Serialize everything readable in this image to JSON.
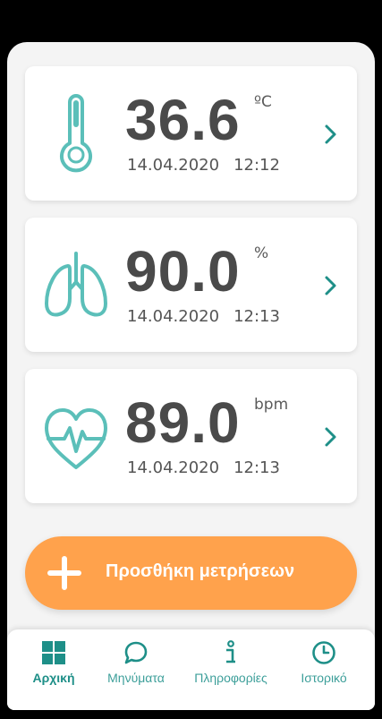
{
  "colors": {
    "accent": "#5bbfb9",
    "tab_accent": "#1e8f88",
    "button": "#ffa24c",
    "value_text": "#4a4a4a"
  },
  "measurements": [
    {
      "icon": "thermometer-icon",
      "value": "36.6",
      "unit": "ºC",
      "date": "14.04.2020",
      "time": "12:12"
    },
    {
      "icon": "lungs-icon",
      "value": "90.0",
      "unit": "%",
      "date": "14.04.2020",
      "time": "12:13"
    },
    {
      "icon": "heart-rate-icon",
      "value": "89.0",
      "unit": "bpm",
      "date": "14.04.2020",
      "time": "12:13"
    }
  ],
  "add_button": {
    "icon": "plus-icon",
    "label": "Προσθήκη μετρήσεων"
  },
  "tabs": [
    {
      "icon": "grid-icon",
      "label": "Αρχική",
      "active": true
    },
    {
      "icon": "chat-bubble-icon",
      "label": "Μηνύματα",
      "active": false
    },
    {
      "icon": "info-icon",
      "label": "Πληροφορίες",
      "active": false
    },
    {
      "icon": "clock-icon",
      "label": "Ιστορικό",
      "active": false
    }
  ]
}
